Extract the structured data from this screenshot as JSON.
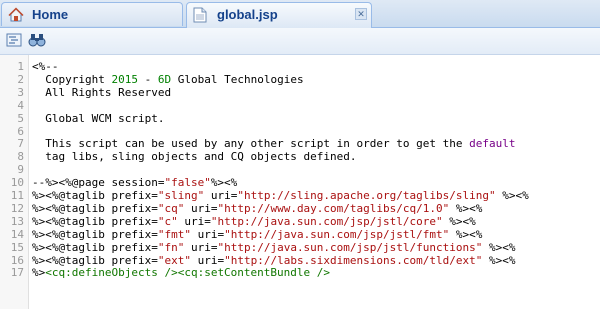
{
  "tabs": [
    {
      "label": "Home"
    },
    {
      "label": "global.jsp"
    }
  ],
  "toolbar": {
    "buttons": [
      "format-icon",
      "find-icon"
    ]
  },
  "editor": {
    "lines": [
      [
        {
          "t": "<%--",
          "c": "plain"
        }
      ],
      [
        {
          "t": "  Copyright ",
          "c": "plain"
        },
        {
          "t": "2015",
          "c": "num"
        },
        {
          "t": " - ",
          "c": "plain"
        },
        {
          "t": "6D",
          "c": "num"
        },
        {
          "t": " Global Technologies",
          "c": "plain"
        }
      ],
      [
        {
          "t": "  All Rights Reserved",
          "c": "plain"
        }
      ],
      [
        {
          "t": "",
          "c": "plain"
        }
      ],
      [
        {
          "t": "  Global WCM script.",
          "c": "plain"
        }
      ],
      [
        {
          "t": "",
          "c": "plain"
        }
      ],
      [
        {
          "t": "  This script can be used by any other script in order to get the ",
          "c": "plain"
        },
        {
          "t": "default",
          "c": "kw"
        }
      ],
      [
        {
          "t": "  tag libs, sling objects and CQ objects defined.",
          "c": "plain"
        }
      ],
      [
        {
          "t": "",
          "c": "plain"
        }
      ],
      [
        {
          "t": "--%><%@page session=",
          "c": "plain"
        },
        {
          "t": "\"false\"",
          "c": "str"
        },
        {
          "t": "%><%",
          "c": "plain"
        }
      ],
      [
        {
          "t": "%><%@taglib prefix=",
          "c": "plain"
        },
        {
          "t": "\"sling\"",
          "c": "str"
        },
        {
          "t": " uri=",
          "c": "plain"
        },
        {
          "t": "\"http://sling.apache.org/taglibs/sling\"",
          "c": "str"
        },
        {
          "t": " %><%",
          "c": "plain"
        }
      ],
      [
        {
          "t": "%><%@taglib prefix=",
          "c": "plain"
        },
        {
          "t": "\"cq\"",
          "c": "str"
        },
        {
          "t": " uri=",
          "c": "plain"
        },
        {
          "t": "\"http://www.day.com/taglibs/cq/1.0\"",
          "c": "str"
        },
        {
          "t": " %><%",
          "c": "plain"
        }
      ],
      [
        {
          "t": "%><%@taglib prefix=",
          "c": "plain"
        },
        {
          "t": "\"c\"",
          "c": "str"
        },
        {
          "t": " uri=",
          "c": "plain"
        },
        {
          "t": "\"http://java.sun.com/jsp/jstl/core\"",
          "c": "str"
        },
        {
          "t": " %><%",
          "c": "plain"
        }
      ],
      [
        {
          "t": "%><%@taglib prefix=",
          "c": "plain"
        },
        {
          "t": "\"fmt\"",
          "c": "str"
        },
        {
          "t": " uri=",
          "c": "plain"
        },
        {
          "t": "\"http://java.sun.com/jsp/jstl/fmt\"",
          "c": "str"
        },
        {
          "t": " %><%",
          "c": "plain"
        }
      ],
      [
        {
          "t": "%><%@taglib prefix=",
          "c": "plain"
        },
        {
          "t": "\"fn\"",
          "c": "str"
        },
        {
          "t": " uri=",
          "c": "plain"
        },
        {
          "t": "\"http://java.sun.com/jsp/jstl/functions\"",
          "c": "str"
        },
        {
          "t": " %><%",
          "c": "plain"
        }
      ],
      [
        {
          "t": "%><%@taglib prefix=",
          "c": "plain"
        },
        {
          "t": "\"ext\"",
          "c": "str"
        },
        {
          "t": " uri=",
          "c": "plain"
        },
        {
          "t": "\"http://labs.sixdimensions.com/tld/ext\"",
          "c": "str"
        },
        {
          "t": " %><%",
          "c": "plain"
        }
      ],
      [
        {
          "t": "%>",
          "c": "plain"
        },
        {
          "t": "<cq:defineObjects />",
          "c": "tag"
        },
        {
          "t": "<cq:setContentBundle />",
          "c": "tag"
        }
      ]
    ]
  }
}
